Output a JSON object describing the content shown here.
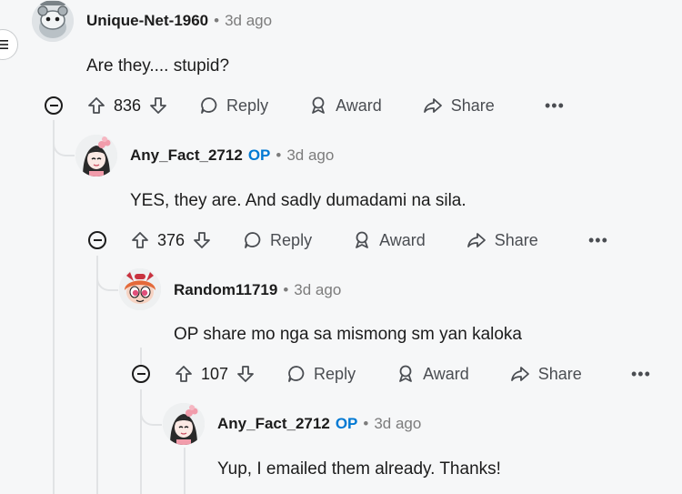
{
  "comments": [
    {
      "username": "Unique-Net-1960",
      "op_badge": "",
      "separator": "•",
      "timestamp": "3d ago",
      "text": "Are they.... stupid?",
      "upvotes": "836",
      "reply_label": "Reply",
      "award_label": "Award",
      "share_label": "Share",
      "more_label": "•••"
    },
    {
      "username": "Any_Fact_2712",
      "op_badge": "OP",
      "separator": "•",
      "timestamp": "3d ago",
      "text": "YES, they are. And sadly dumadami na sila.",
      "upvotes": "376",
      "reply_label": "Reply",
      "award_label": "Award",
      "share_label": "Share",
      "more_label": "•••"
    },
    {
      "username": "Random11719",
      "op_badge": "",
      "separator": "•",
      "timestamp": "3d ago",
      "text": "OP share mo nga sa mismong sm yan kaloka",
      "upvotes": "107",
      "reply_label": "Reply",
      "award_label": "Award",
      "share_label": "Share",
      "more_label": "•••"
    },
    {
      "username": "Any_Fact_2712",
      "op_badge": "OP",
      "separator": "•",
      "timestamp": "3d ago",
      "text": "Yup, I emailed them already. Thanks!"
    }
  ],
  "colors": {
    "op_badge": "#0079d3",
    "meta_gray": "#7c7c7c",
    "thread_line": "#e1e3e5"
  }
}
